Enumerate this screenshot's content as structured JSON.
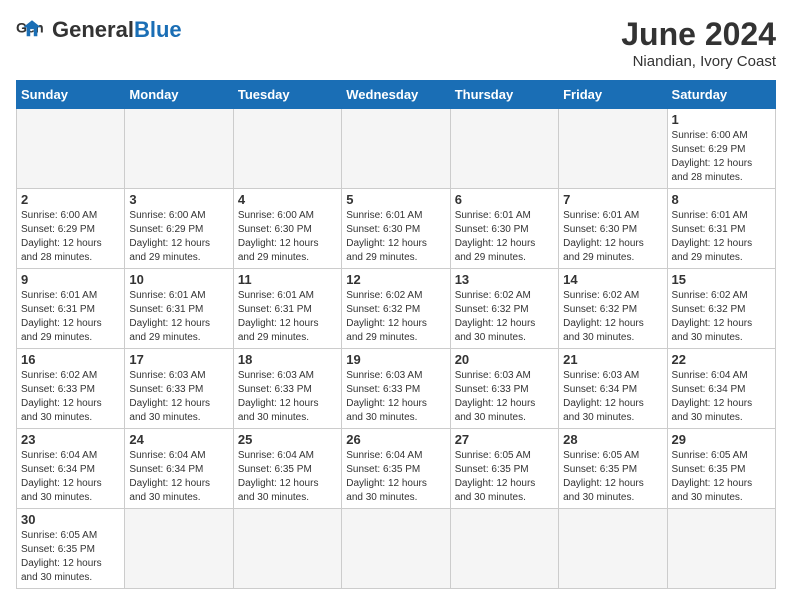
{
  "header": {
    "logo_general": "General",
    "logo_blue": "Blue",
    "month_title": "June 2024",
    "location": "Niandian, Ivory Coast"
  },
  "weekdays": [
    "Sunday",
    "Monday",
    "Tuesday",
    "Wednesday",
    "Thursday",
    "Friday",
    "Saturday"
  ],
  "weeks": [
    [
      {
        "day": "",
        "info": ""
      },
      {
        "day": "",
        "info": ""
      },
      {
        "day": "",
        "info": ""
      },
      {
        "day": "",
        "info": ""
      },
      {
        "day": "",
        "info": ""
      },
      {
        "day": "",
        "info": ""
      },
      {
        "day": "1",
        "info": "Sunrise: 6:00 AM\nSunset: 6:29 PM\nDaylight: 12 hours\nand 28 minutes."
      }
    ],
    [
      {
        "day": "2",
        "info": "Sunrise: 6:00 AM\nSunset: 6:29 PM\nDaylight: 12 hours\nand 28 minutes."
      },
      {
        "day": "3",
        "info": "Sunrise: 6:00 AM\nSunset: 6:29 PM\nDaylight: 12 hours\nand 29 minutes."
      },
      {
        "day": "4",
        "info": "Sunrise: 6:00 AM\nSunset: 6:30 PM\nDaylight: 12 hours\nand 29 minutes."
      },
      {
        "day": "5",
        "info": "Sunrise: 6:01 AM\nSunset: 6:30 PM\nDaylight: 12 hours\nand 29 minutes."
      },
      {
        "day": "6",
        "info": "Sunrise: 6:01 AM\nSunset: 6:30 PM\nDaylight: 12 hours\nand 29 minutes."
      },
      {
        "day": "7",
        "info": "Sunrise: 6:01 AM\nSunset: 6:30 PM\nDaylight: 12 hours\nand 29 minutes."
      },
      {
        "day": "8",
        "info": "Sunrise: 6:01 AM\nSunset: 6:31 PM\nDaylight: 12 hours\nand 29 minutes."
      }
    ],
    [
      {
        "day": "9",
        "info": "Sunrise: 6:01 AM\nSunset: 6:31 PM\nDaylight: 12 hours\nand 29 minutes."
      },
      {
        "day": "10",
        "info": "Sunrise: 6:01 AM\nSunset: 6:31 PM\nDaylight: 12 hours\nand 29 minutes."
      },
      {
        "day": "11",
        "info": "Sunrise: 6:01 AM\nSunset: 6:31 PM\nDaylight: 12 hours\nand 29 minutes."
      },
      {
        "day": "12",
        "info": "Sunrise: 6:02 AM\nSunset: 6:32 PM\nDaylight: 12 hours\nand 29 minutes."
      },
      {
        "day": "13",
        "info": "Sunrise: 6:02 AM\nSunset: 6:32 PM\nDaylight: 12 hours\nand 30 minutes."
      },
      {
        "day": "14",
        "info": "Sunrise: 6:02 AM\nSunset: 6:32 PM\nDaylight: 12 hours\nand 30 minutes."
      },
      {
        "day": "15",
        "info": "Sunrise: 6:02 AM\nSunset: 6:32 PM\nDaylight: 12 hours\nand 30 minutes."
      }
    ],
    [
      {
        "day": "16",
        "info": "Sunrise: 6:02 AM\nSunset: 6:33 PM\nDaylight: 12 hours\nand 30 minutes."
      },
      {
        "day": "17",
        "info": "Sunrise: 6:03 AM\nSunset: 6:33 PM\nDaylight: 12 hours\nand 30 minutes."
      },
      {
        "day": "18",
        "info": "Sunrise: 6:03 AM\nSunset: 6:33 PM\nDaylight: 12 hours\nand 30 minutes."
      },
      {
        "day": "19",
        "info": "Sunrise: 6:03 AM\nSunset: 6:33 PM\nDaylight: 12 hours\nand 30 minutes."
      },
      {
        "day": "20",
        "info": "Sunrise: 6:03 AM\nSunset: 6:33 PM\nDaylight: 12 hours\nand 30 minutes."
      },
      {
        "day": "21",
        "info": "Sunrise: 6:03 AM\nSunset: 6:34 PM\nDaylight: 12 hours\nand 30 minutes."
      },
      {
        "day": "22",
        "info": "Sunrise: 6:04 AM\nSunset: 6:34 PM\nDaylight: 12 hours\nand 30 minutes."
      }
    ],
    [
      {
        "day": "23",
        "info": "Sunrise: 6:04 AM\nSunset: 6:34 PM\nDaylight: 12 hours\nand 30 minutes."
      },
      {
        "day": "24",
        "info": "Sunrise: 6:04 AM\nSunset: 6:34 PM\nDaylight: 12 hours\nand 30 minutes."
      },
      {
        "day": "25",
        "info": "Sunrise: 6:04 AM\nSunset: 6:35 PM\nDaylight: 12 hours\nand 30 minutes."
      },
      {
        "day": "26",
        "info": "Sunrise: 6:04 AM\nSunset: 6:35 PM\nDaylight: 12 hours\nand 30 minutes."
      },
      {
        "day": "27",
        "info": "Sunrise: 6:05 AM\nSunset: 6:35 PM\nDaylight: 12 hours\nand 30 minutes."
      },
      {
        "day": "28",
        "info": "Sunrise: 6:05 AM\nSunset: 6:35 PM\nDaylight: 12 hours\nand 30 minutes."
      },
      {
        "day": "29",
        "info": "Sunrise: 6:05 AM\nSunset: 6:35 PM\nDaylight: 12 hours\nand 30 minutes."
      }
    ],
    [
      {
        "day": "30",
        "info": "Sunrise: 6:05 AM\nSunset: 6:35 PM\nDaylight: 12 hours\nand 30 minutes."
      },
      {
        "day": "",
        "info": ""
      },
      {
        "day": "",
        "info": ""
      },
      {
        "day": "",
        "info": ""
      },
      {
        "day": "",
        "info": ""
      },
      {
        "day": "",
        "info": ""
      },
      {
        "day": "",
        "info": ""
      }
    ]
  ]
}
